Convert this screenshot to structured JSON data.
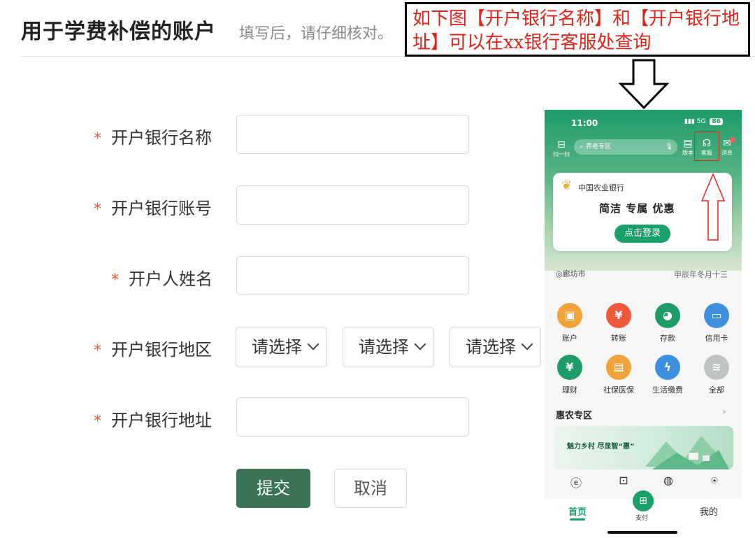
{
  "form": {
    "title": "用于学费补偿的账户",
    "subtitle": "填写后，请仔细核对。",
    "fields": [
      {
        "label": "开户银行名称"
      },
      {
        "label": "开户银行账号"
      },
      {
        "label": "开户人姓名"
      },
      {
        "label": "开户银行地区"
      },
      {
        "label": "开户银行地址"
      }
    ],
    "required_mark": "*",
    "region_selects": [
      "请选择",
      "请选择",
      "请选择"
    ],
    "submit_label": "提交",
    "cancel_label": "取消"
  },
  "annotation": {
    "note": "如下图【开户银行名称】和【开户银行地址】可以在xx银行客服处查询",
    "highlight_color": "#e0241b"
  },
  "phone": {
    "time": "11:00",
    "network": "5G",
    "battery": "86",
    "scan_label": "扫一扫",
    "search_placeholder": "养老专区",
    "top_icons": [
      {
        "icon": "version-icon",
        "label": "版本"
      },
      {
        "icon": "headset-icon",
        "label": "客服"
      },
      {
        "icon": "mail-icon",
        "label": "消息"
      }
    ],
    "bank_name": "中国农业银行",
    "slogan": "简洁  专属  优惠",
    "login_label": "点击登录",
    "location": "廊坊市",
    "lunar_date": "甲辰年冬月十三",
    "services": [
      {
        "label": "账户",
        "icon": "wallet-icon",
        "color": "#f0a23b"
      },
      {
        "label": "转账",
        "icon": "transfer-icon",
        "color": "#ef5a3c"
      },
      {
        "label": "存款",
        "icon": "piggy-icon",
        "color": "#1e9b68"
      },
      {
        "label": "信用卡",
        "icon": "card-icon",
        "color": "#3d8fe0"
      },
      {
        "label": "理财",
        "icon": "money-bag-icon",
        "color": "#1e9b68"
      },
      {
        "label": "社保医保",
        "icon": "id-card-icon",
        "color": "#f0a23b"
      },
      {
        "label": "生活缴费",
        "icon": "drop-icon",
        "color": "#3d8fe0"
      },
      {
        "label": "全部",
        "icon": "layers-icon",
        "color": "#bfc3c2"
      }
    ],
    "section_title": "惠农专区",
    "banner_text": "魅力乡村  尽显智“惠”",
    "nav": {
      "home": "首页",
      "pay": "支付",
      "mine": "我的"
    },
    "brand_color": "#1aa06b"
  }
}
